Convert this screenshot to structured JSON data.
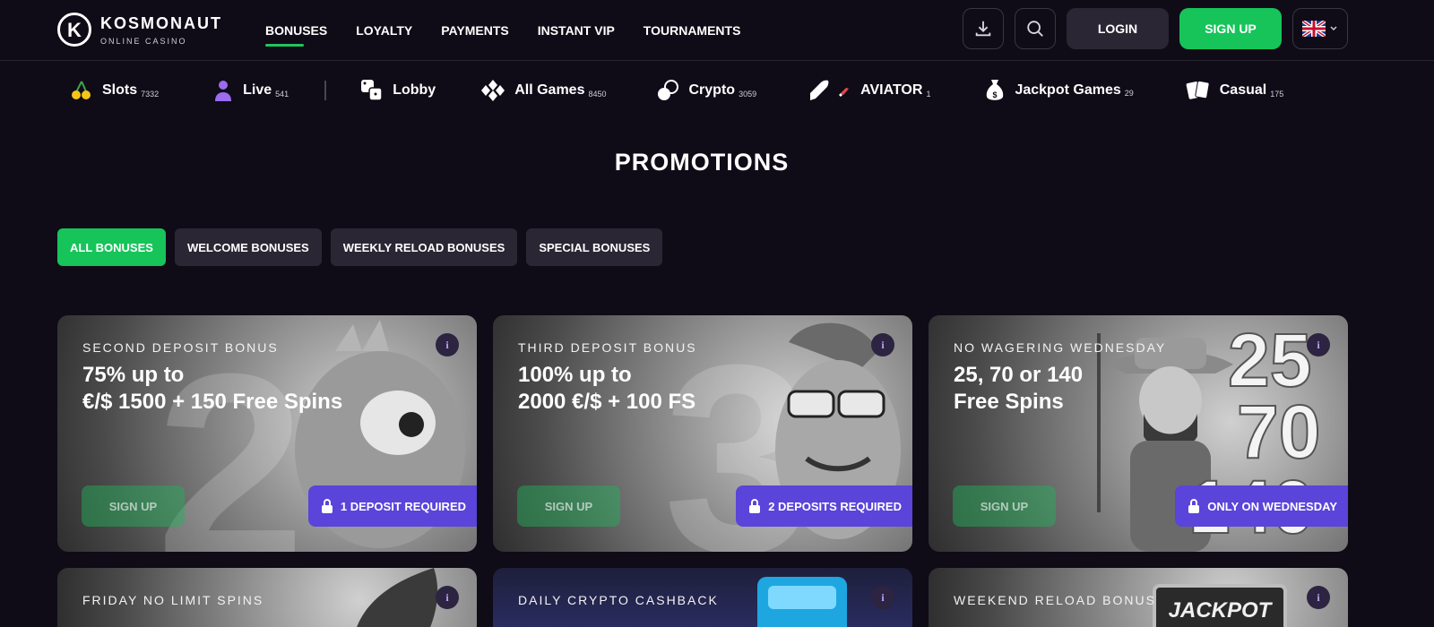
{
  "logo": {
    "name": "KOSMONAUT",
    "sub": "ONLINE CASINO"
  },
  "nav": [
    {
      "label": "BONUSES",
      "active": true
    },
    {
      "label": "LOYALTY"
    },
    {
      "label": "PAYMENTS"
    },
    {
      "label": "INSTANT VIP"
    },
    {
      "label": "TOURNAMENTS"
    }
  ],
  "header": {
    "login": "LOGIN",
    "signup": "SIGN UP",
    "accent": "#16c45a"
  },
  "categories": [
    {
      "label": "Slots",
      "count": "7332",
      "icon": "cherries-icon"
    },
    {
      "label": "Live",
      "count": "541",
      "icon": "dealer-icon"
    },
    {
      "label": "Lobby",
      "count": "",
      "icon": "dice-icon"
    },
    {
      "label": "All Games",
      "count": "8450",
      "icon": "diamonds-icon"
    },
    {
      "label": "Crypto",
      "count": "3059",
      "icon": "coins-icon"
    },
    {
      "label": "AVIATOR",
      "count": "1",
      "icon": "rocket-icon"
    },
    {
      "label": "Jackpot Games",
      "count": "29",
      "icon": "money-bag-icon"
    },
    {
      "label": "Casual",
      "count": "175",
      "icon": "cards-icon"
    }
  ],
  "page_title": "PROMOTIONS",
  "filters": [
    {
      "label": "ALL BONUSES",
      "active": true
    },
    {
      "label": "WELCOME BONUSES"
    },
    {
      "label": "WEEKLY RELOAD BONUSES"
    },
    {
      "label": "SPECIAL BONUSES"
    }
  ],
  "cards": [
    {
      "kicker": "SECOND DEPOSIT BONUS",
      "line1": "75% up to",
      "line2": "€/$ 1500 + 150 Free Spins",
      "cta": "SIGN UP",
      "req": "1 DEPOSIT REQUIRED",
      "big": "2"
    },
    {
      "kicker": "THIRD DEPOSIT BONUS",
      "line1": "100% up to",
      "line2": "2000 €/$ + 100 FS",
      "cta": "SIGN UP",
      "req": "2 DEPOSITS REQUIRED",
      "big": "3"
    },
    {
      "kicker": "NO WAGERING WEDNESDAY",
      "line1": "25, 70 or 140",
      "line2": "Free Spins",
      "cta": "SIGN UP",
      "req": "ONLY ON WEDNESDAY",
      "big_numbers": [
        "25",
        "70",
        "140"
      ]
    },
    {
      "kicker": "FRIDAY NO LIMIT SPINS"
    },
    {
      "kicker": "DAILY CRYPTO CASHBACK"
    },
    {
      "kicker": "WEEKEND RELOAD BONUS",
      "badge": "JACKPOT"
    }
  ],
  "info_glyph": "i"
}
